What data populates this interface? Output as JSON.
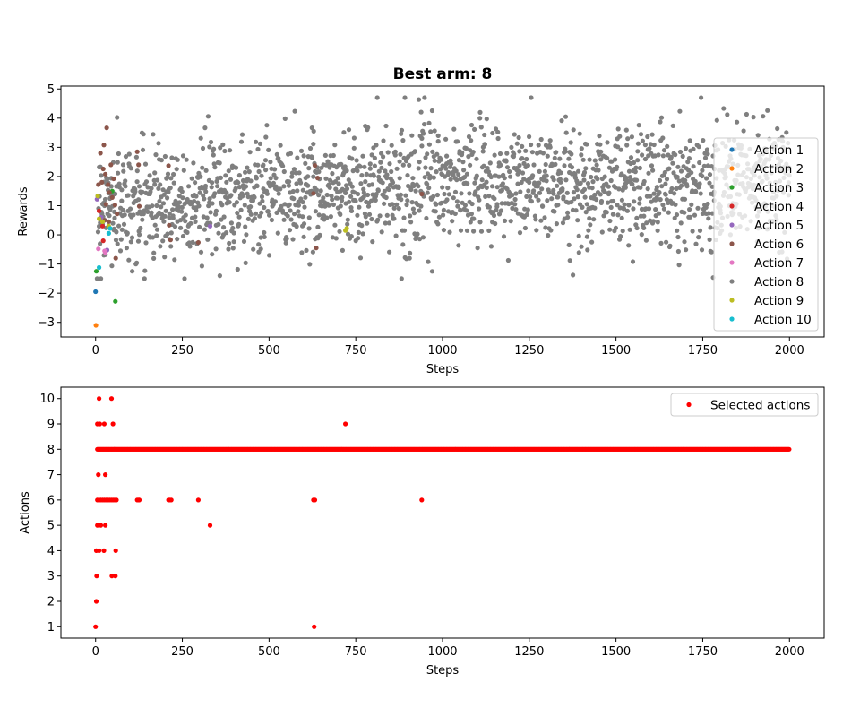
{
  "chart_data": [
    {
      "type": "scatter",
      "title": "Best arm: 8",
      "xlabel": "Steps",
      "ylabel": "Rewards",
      "xlim": [
        -100,
        2100
      ],
      "ylim": [
        -3.5,
        5.1
      ],
      "xticks": [
        0,
        250,
        500,
        750,
        1000,
        1250,
        1500,
        1750,
        2000
      ],
      "yticks": [
        -3,
        -2,
        -1,
        0,
        1,
        2,
        3,
        4,
        5
      ],
      "grid": false,
      "legend_position": "center-right",
      "series": [
        {
          "name": "Action 1",
          "color": "#1f77b4",
          "points": [
            [
              0,
              -1.95
            ]
          ]
        },
        {
          "name": "Action 2",
          "color": "#ff7f0e",
          "points": [
            [
              1,
              -3.1
            ]
          ]
        },
        {
          "name": "Action 3",
          "color": "#2ca02c",
          "points": [
            [
              2,
              -1.25
            ],
            [
              48,
              1.5
            ],
            [
              57,
              -2.28
            ]
          ]
        },
        {
          "name": "Action 4",
          "color": "#d62728",
          "points": [
            [
              10,
              0.82
            ],
            [
              22,
              -0.2
            ],
            [
              20,
              0.3
            ]
          ]
        },
        {
          "name": "Action 5",
          "color": "#9467bd",
          "points": [
            [
              4,
              1.22
            ],
            [
              16,
              0.6
            ],
            [
              33,
              -0.52
            ],
            [
              330,
              0.3
            ]
          ]
        },
        {
          "name": "Action 6",
          "color": "#8c564b",
          "points": [
            [
              8,
              1.72
            ],
            [
              14,
              2.8
            ],
            [
              18,
              1.8
            ],
            [
              22,
              2.26
            ],
            [
              24,
              3.08
            ],
            [
              28,
              2.08
            ],
            [
              32,
              3.67
            ],
            [
              36,
              1.72
            ],
            [
              40,
              1.45
            ],
            [
              44,
              2.4
            ],
            [
              48,
              1.28
            ],
            [
              52,
              1.92
            ],
            [
              56,
              1.02
            ],
            [
              58,
              -0.8
            ],
            [
              62,
              0.72
            ],
            [
              120,
              2.85
            ],
            [
              124,
              2.4
            ],
            [
              126,
              0.98
            ],
            [
              210,
              2.37
            ],
            [
              212,
              0.33
            ],
            [
              216,
              -0.17
            ],
            [
              296,
              -0.26
            ],
            [
              628,
              1.42
            ],
            [
              632,
              2.38
            ],
            [
              636,
              -0.45
            ],
            [
              640,
              1.95
            ],
            [
              940,
              1.4
            ],
            [
              26,
              0.5
            ],
            [
              38,
              0.45
            ],
            [
              30,
              1.05
            ]
          ]
        },
        {
          "name": "Action 7",
          "color": "#e377c2",
          "points": [
            [
              8,
              -0.48
            ],
            [
              26,
              -0.55
            ],
            [
              28,
              -0.6
            ]
          ]
        },
        {
          "name": "Action 8",
          "color": "#7f7f7f",
          "points_generated": {
            "count": 1900,
            "x_range": [
              5,
              2000
            ],
            "mean_start": 1.0,
            "mean_end": 1.75,
            "std": 1.0,
            "y_min": -1.5,
            "y_max": 4.7
          }
        },
        {
          "name": "Action 9",
          "color": "#bcbd22",
          "points": [
            [
              6,
              1.33
            ],
            [
              10,
              0.55
            ],
            [
              20,
              0.45
            ],
            [
              38,
              0.3
            ],
            [
              720,
              0.15
            ],
            [
              724,
              0.22
            ]
          ]
        },
        {
          "name": "Action 10",
          "color": "#17becf",
          "points": [
            [
              10,
              -1.12
            ],
            [
              38,
              0.05
            ],
            [
              42,
              0.22
            ]
          ]
        }
      ]
    },
    {
      "type": "scatter",
      "title": "",
      "xlabel": "Steps",
      "ylabel": "Actions",
      "xlim": [
        -100,
        2100
      ],
      "ylim": [
        0.55,
        10.45
      ],
      "xticks": [
        0,
        250,
        500,
        750,
        1000,
        1250,
        1500,
        1750,
        2000
      ],
      "yticks": [
        1,
        2,
        3,
        4,
        5,
        6,
        7,
        8,
        9,
        10
      ],
      "grid": false,
      "legend_position": "top-right",
      "series": [
        {
          "name": "Selected actions",
          "color": "#ff0000",
          "dense_runs": [
            {
              "action": 8,
              "x_start": 5,
              "x_end": 2000
            }
          ],
          "points": [
            [
              0,
              1
            ],
            [
              630,
              1
            ],
            [
              2,
              2
            ],
            [
              3,
              3
            ],
            [
              47,
              3
            ],
            [
              57,
              3
            ],
            [
              2,
              4
            ],
            [
              10,
              4
            ],
            [
              24,
              4
            ],
            [
              58,
              4
            ],
            [
              5,
              5
            ],
            [
              15,
              5
            ],
            [
              28,
              5
            ],
            [
              330,
              5
            ],
            [
              5,
              6
            ],
            [
              10,
              6
            ],
            [
              15,
              6
            ],
            [
              20,
              6
            ],
            [
              25,
              6
            ],
            [
              30,
              6
            ],
            [
              35,
              6
            ],
            [
              40,
              6
            ],
            [
              45,
              6
            ],
            [
              50,
              6
            ],
            [
              55,
              6
            ],
            [
              60,
              6
            ],
            [
              120,
              6
            ],
            [
              124,
              6
            ],
            [
              126,
              6
            ],
            [
              210,
              6
            ],
            [
              214,
              6
            ],
            [
              218,
              6
            ],
            [
              296,
              6
            ],
            [
              628,
              6
            ],
            [
              632,
              6
            ],
            [
              940,
              6
            ],
            [
              8,
              7
            ],
            [
              28,
              7
            ],
            [
              5,
              9
            ],
            [
              12,
              9
            ],
            [
              25,
              9
            ],
            [
              50,
              9
            ],
            [
              720,
              9
            ],
            [
              10,
              10
            ],
            [
              46,
              10
            ]
          ]
        }
      ]
    }
  ]
}
